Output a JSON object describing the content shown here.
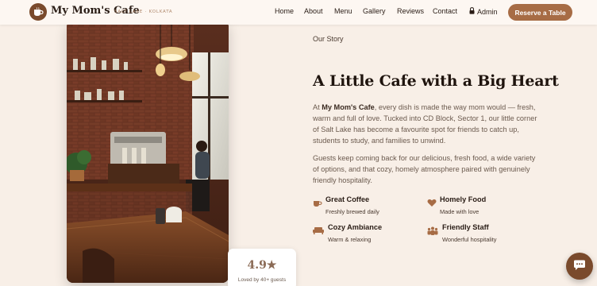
{
  "brand": {
    "name": "My Mom's Cafe",
    "tagline": "SALT LAKE · KOLKATA",
    "logo_icon": "cup-icon"
  },
  "nav": {
    "links": [
      "Home",
      "About",
      "Menu",
      "Gallery",
      "Reviews",
      "Contact"
    ],
    "admin_label": "Admin",
    "admin_icon": "lock-icon",
    "reserve_label": "Reserve a Table"
  },
  "rating": {
    "value": "4.9★",
    "caption": "Loved by 40+ guests"
  },
  "story": {
    "eyebrow": "Our Story",
    "headline": "A Little Cafe with a Big Heart",
    "para1_brand": "My Mom's Cafe",
    "para1_prefix": "At ",
    "para1_rest": ", every dish is made the way mom would — fresh, warm and full of love. Tucked into CD Block, Sector 1, our little corner of Salt Lake has become a favourite spot for friends to catch up, students to study, and families to unwind.",
    "para2": "Guests keep coming back for our delicious, fresh food, a wide variety of options, and that cozy, homely atmosphere paired with genuinely friendly hospitality."
  },
  "features": [
    {
      "title": "Great Coffee",
      "subtitle": "Freshly brewed daily",
      "icon": "coffee-cup-icon"
    },
    {
      "title": "Homely Food",
      "subtitle": "Made with love",
      "icon": "heart-icon"
    },
    {
      "title": "Cozy Ambiance",
      "subtitle": "Warm & relaxing",
      "icon": "couch-icon"
    },
    {
      "title": "Friendly Staff",
      "subtitle": "Wonderful hospitality",
      "icon": "people-icon"
    }
  ],
  "colors": {
    "accent": "#a76c45",
    "brand_dark": "#7a4a2c",
    "background": "#f8efe7"
  },
  "chat_icon": "chat-bubble-icon"
}
